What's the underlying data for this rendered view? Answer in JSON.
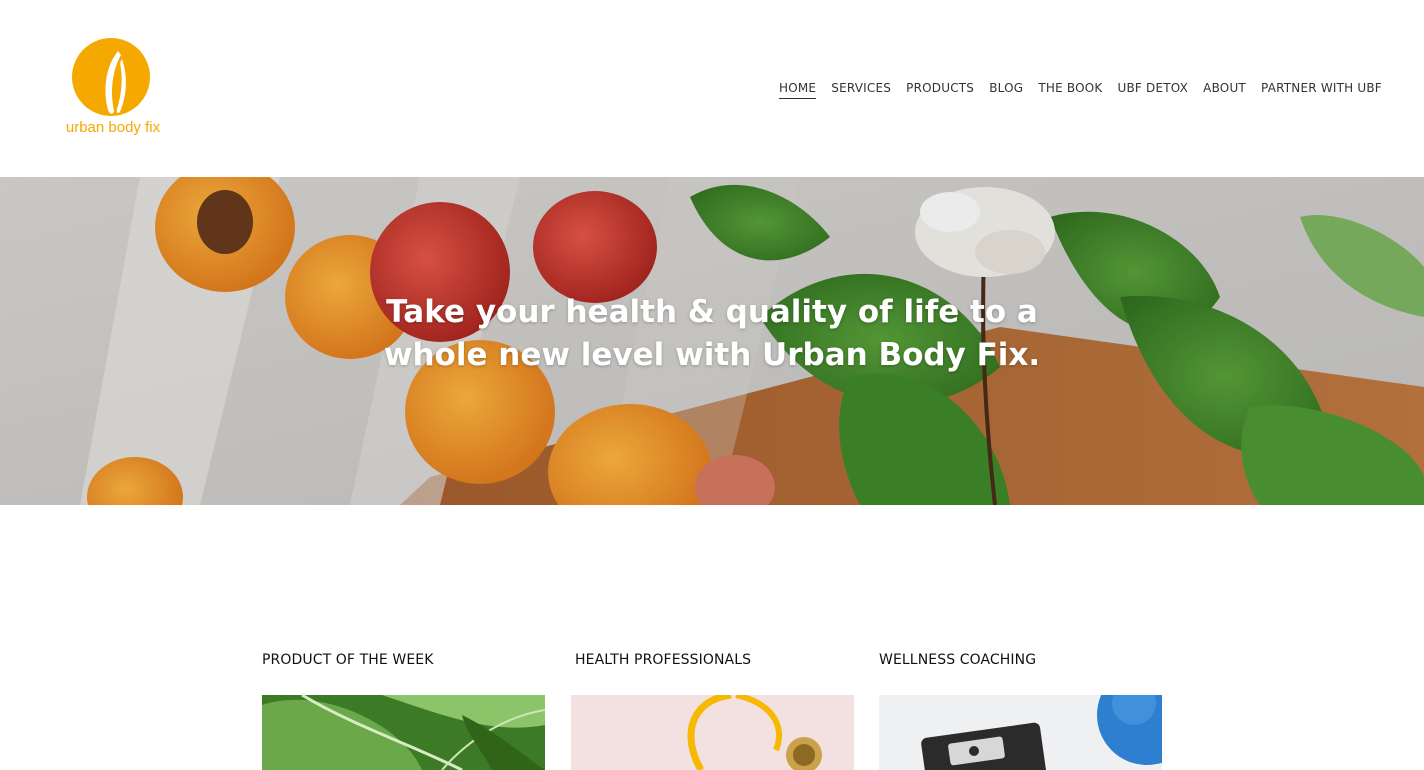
{
  "brand": {
    "name": "urban body fix",
    "accent": "#f5a800"
  },
  "nav": {
    "items": [
      {
        "label": "HOME",
        "active": true
      },
      {
        "label": "SERVICES"
      },
      {
        "label": "PRODUCTS"
      },
      {
        "label": "BLOG"
      },
      {
        "label": "THE BOOK"
      },
      {
        "label": "UBF DETOX"
      },
      {
        "label": "ABOUT"
      },
      {
        "label": "PARTNER WITH UBF"
      }
    ]
  },
  "hero": {
    "line1": "Take your health & quality of life to a",
    "line2": "whole new level with Urban Body Fix."
  },
  "features": [
    {
      "title": "PRODUCT OF THE WEEK",
      "image": "leafy-greens"
    },
    {
      "title": "HEALTH PROFESSIONALS",
      "image": "stethoscope"
    },
    {
      "title": "WELLNESS COACHING",
      "image": "scale-and-ball"
    }
  ]
}
